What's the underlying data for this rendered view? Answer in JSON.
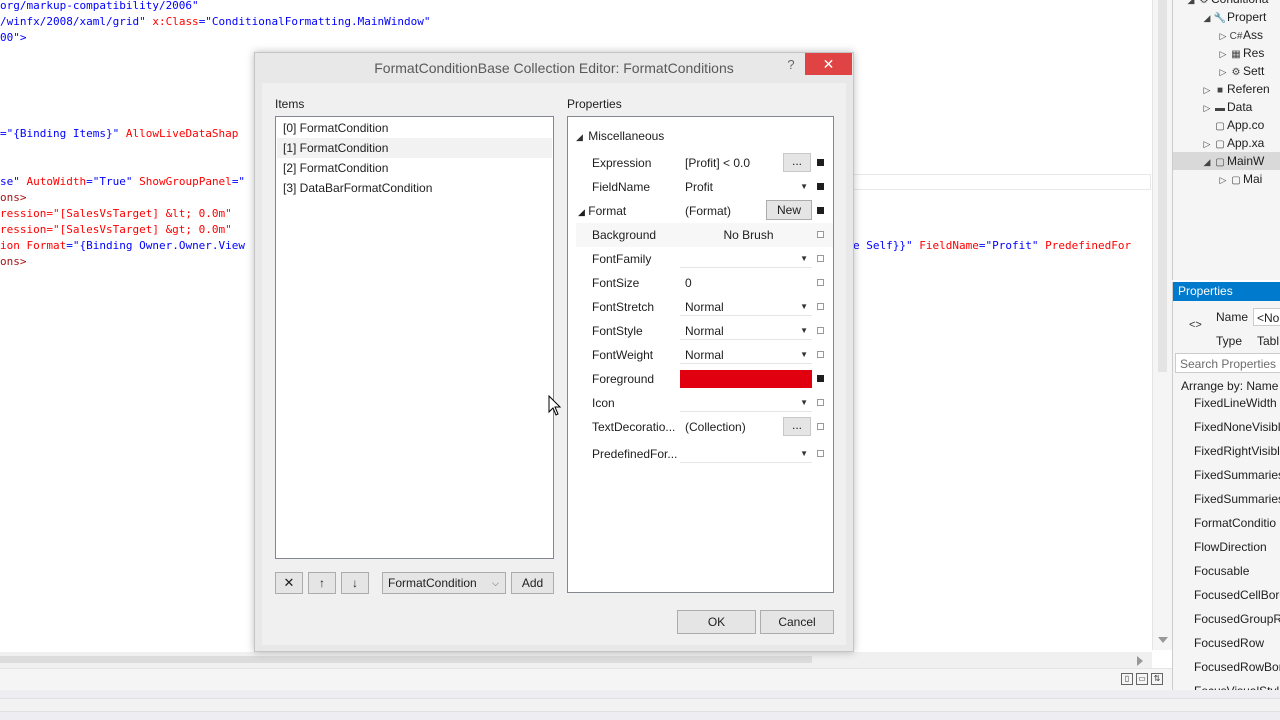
{
  "editor": {
    "lines": [
      {
        "parts": [
          {
            "t": "org/markup-compatibility/2006\"",
            "c": "kw-blue"
          }
        ]
      },
      {
        "parts": [
          {
            "t": "/winfx/2008/xaml/grid\"",
            "c": "kw-blue"
          },
          {
            "t": " x:Class",
            "c": "kw-red"
          },
          {
            "t": "=\"ConditionalFormatting.MainWindow\"",
            "c": "kw-blue"
          }
        ]
      },
      {
        "parts": [
          {
            "t": "00\">",
            "c": "kw-blue"
          }
        ]
      },
      {
        "parts": []
      },
      {
        "parts": []
      },
      {
        "parts": []
      },
      {
        "parts": []
      },
      {
        "parts": []
      },
      {
        "parts": [
          {
            "t": "=\"{Binding Items}\"",
            "c": "kw-blue"
          },
          {
            "t": " AllowLiveDataShap",
            "c": "kw-red"
          }
        ]
      },
      {
        "parts": []
      },
      {
        "parts": []
      },
      {
        "parts": [
          {
            "t": "se\"",
            "c": "kw-blue"
          },
          {
            "t": " AutoWidth",
            "c": "kw-red"
          },
          {
            "t": "=\"True\"",
            "c": "kw-blue"
          },
          {
            "t": " ShowGroupPanel",
            "c": "kw-red"
          },
          {
            "t": "=\"",
            "c": "kw-blue"
          }
        ]
      },
      {
        "parts": [
          {
            "t": "ons>",
            "c": "kw-brown"
          }
        ]
      },
      {
        "parts": [
          {
            "t": "ression=\"[SalesVsTarget] &lt; 0.0m\"",
            "c": "kw-red"
          }
        ]
      },
      {
        "parts": [
          {
            "t": "ression=\"[SalesVsTarget] &gt; 0.0m\"",
            "c": "kw-red"
          }
        ]
      },
      {
        "parts": [
          {
            "t": "ion Format",
            "c": "kw-red"
          },
          {
            "t": "=\"{Binding Owner.Owner.View",
            "c": "kw-blue"
          }
        ]
      },
      {
        "parts": [
          {
            "t": "ons>",
            "c": "kw-brown"
          }
        ]
      }
    ],
    "right_fragment": {
      "parts": [
        {
          "t": "e Self}}\"",
          "c": "kw-blue"
        },
        {
          "t": " FieldName",
          "c": "kw-red"
        },
        {
          "t": "=\"Profit\"",
          "c": "kw-blue"
        },
        {
          "t": " PredefinedFor",
          "c": "kw-red"
        }
      ]
    }
  },
  "solution": {
    "items": [
      {
        "indent": 1,
        "arrow": "◢",
        "icon": "⚙",
        "label": "Conditiona",
        "icon_name": "project-icon"
      },
      {
        "indent": 2,
        "arrow": "◢",
        "icon": "🔧",
        "label": "Propert",
        "icon_name": "wrench-icon"
      },
      {
        "indent": 3,
        "arrow": "▷",
        "icon": "C#",
        "label": "Ass",
        "icon_name": "csharp-file-icon"
      },
      {
        "indent": 3,
        "arrow": "▷",
        "icon": "▦",
        "label": "Res",
        "icon_name": "resources-icon"
      },
      {
        "indent": 3,
        "arrow": "▷",
        "icon": "⚙",
        "label": "Sett",
        "icon_name": "settings-icon"
      },
      {
        "indent": 2,
        "arrow": "▷",
        "icon": "■",
        "label": "Referen",
        "icon_name": "references-icon"
      },
      {
        "indent": 2,
        "arrow": "▷",
        "icon": "▬",
        "label": "Data",
        "icon_name": "folder-icon"
      },
      {
        "indent": 2,
        "arrow": "",
        "icon": "▢",
        "label": "App.co",
        "icon_name": "config-file-icon"
      },
      {
        "indent": 2,
        "arrow": "▷",
        "icon": "▢",
        "label": "App.xa",
        "icon_name": "xaml-file-icon"
      },
      {
        "indent": 2,
        "arrow": "◢",
        "icon": "▢",
        "label": "MainW",
        "icon_name": "xaml-file-icon",
        "selected": true
      },
      {
        "indent": 3,
        "arrow": "▷",
        "icon": "▢",
        "label": "Mai",
        "icon_name": "cs-file-icon"
      }
    ]
  },
  "properties_panel": {
    "header": "Properties",
    "name_label": "Name",
    "name_value": "<No",
    "type_label": "Type",
    "type_value": "Tabl",
    "search_placeholder": "Search Properties",
    "arrange_by": "Arrange by: Name",
    "list": [
      "FixedLineWidth",
      "FixedNoneVisibl",
      "FixedRightVisibl",
      "FixedSummaries",
      "FixedSummaries",
      "FormatConditio",
      "FlowDirection",
      "Focusable",
      "FocusedCellBord",
      "FocusedGroupRo",
      "FocusedRow",
      "FocusedRowBord",
      "FocusVisualStyle"
    ]
  },
  "dialog": {
    "title": "FormatConditionBase Collection Editor: FormatConditions",
    "help": "?",
    "close": "✕",
    "items_label": "Items",
    "properties_label": "Properties",
    "items": [
      "[0] FormatCondition",
      "[1] FormatCondition",
      "[2] FormatCondition",
      "[3] DataBarFormatCondition"
    ],
    "selected_index": 1,
    "toolbar": {
      "delete": "✕",
      "move_up": "↑",
      "move_down": "↓",
      "type_combo": "FormatCondition",
      "add": "Add"
    },
    "grid": {
      "category": "Miscellaneous",
      "expression_label": "Expression",
      "expression_value": "[Profit] < 0.0",
      "fieldname_label": "FieldName",
      "fieldname_value": "Profit",
      "format_label": "Format",
      "format_value": "(Format)",
      "format_button": "New",
      "sub": [
        {
          "name": "Background",
          "value": "No Brush",
          "kind": "center"
        },
        {
          "name": "FontFamily",
          "value": "",
          "kind": "combo"
        },
        {
          "name": "FontSize",
          "value": "0",
          "kind": "text"
        },
        {
          "name": "FontStretch",
          "value": "Normal",
          "kind": "combo"
        },
        {
          "name": "FontStyle",
          "value": "Normal",
          "kind": "combo"
        },
        {
          "name": "FontWeight",
          "value": "Normal",
          "kind": "combo"
        },
        {
          "name": "Foreground",
          "value": "",
          "kind": "color"
        },
        {
          "name": "Icon",
          "value": "",
          "kind": "combo"
        },
        {
          "name": "TextDecoratio...",
          "value": "(Collection)",
          "kind": "ellipsis"
        },
        {
          "name": "PredefinedFor...",
          "value": "",
          "kind": "combo"
        }
      ],
      "ellipsis": "...",
      "foreground_color": "#e0000f"
    },
    "ok": "OK",
    "cancel": "Cancel"
  },
  "colors": {
    "accent": "#007acc",
    "close_red": "#e04343"
  }
}
